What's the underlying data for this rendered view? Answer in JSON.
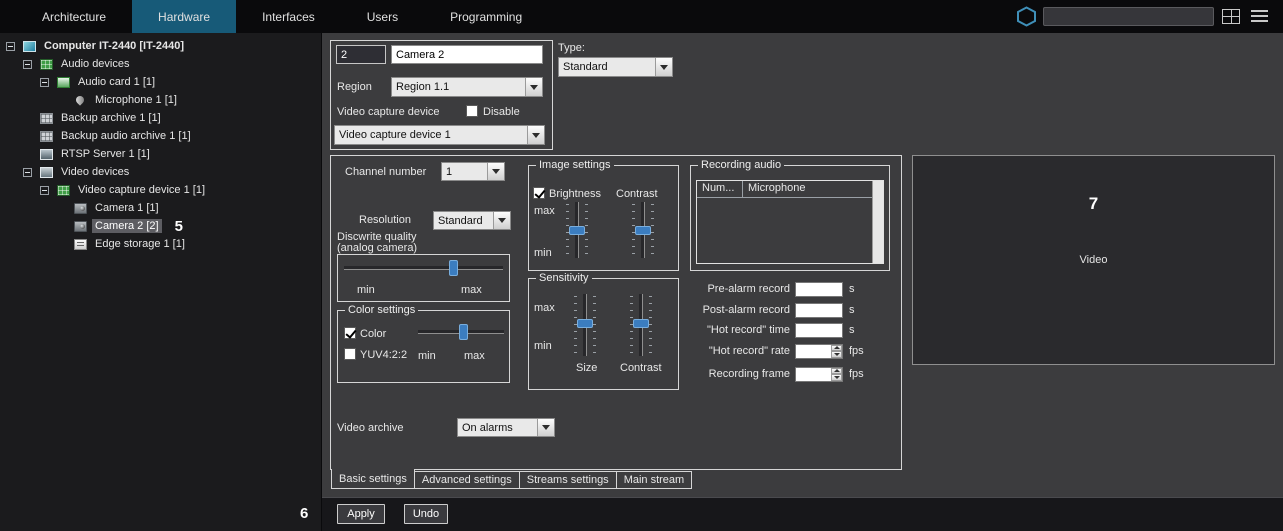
{
  "topbar": {
    "menu": [
      {
        "label": "Architecture",
        "active": false
      },
      {
        "label": "Hardware",
        "active": true
      },
      {
        "label": "Interfaces",
        "active": false
      },
      {
        "label": "Users",
        "active": false
      },
      {
        "label": "Programming",
        "active": false
      }
    ],
    "search_value": ""
  },
  "tree": {
    "items": [
      {
        "label": "Computer IT-2440 [IT-2440]",
        "level": 0,
        "icon": "computer",
        "expander": true,
        "bold": true,
        "selected": false
      },
      {
        "label": "Audio devices",
        "level": 1,
        "icon": "audio-devices",
        "expander": true
      },
      {
        "label": "Audio card 1 [1]",
        "level": 2,
        "icon": "audio-card",
        "expander": true
      },
      {
        "label": "Microphone 1 [1]",
        "level": 3,
        "icon": "microphone"
      },
      {
        "label": "Backup archive 1 [1]",
        "level": 1,
        "icon": "backup-archive"
      },
      {
        "label": "Backup audio archive 1 [1]",
        "level": 1,
        "icon": "backup-audio-archive"
      },
      {
        "label": "RTSP Server 1 [1]",
        "level": 1,
        "icon": "rtsp-server"
      },
      {
        "label": "Video devices",
        "level": 1,
        "icon": "video-devices",
        "expander": true
      },
      {
        "label": "Video capture device 1 [1]",
        "level": 2,
        "icon": "video-capture-device",
        "expander": true
      },
      {
        "label": "Camera 1 [1]",
        "level": 3,
        "icon": "camera"
      },
      {
        "label": "Camera 2 [2]",
        "level": 3,
        "icon": "camera",
        "selected": true,
        "annotation": "5"
      },
      {
        "label": "Edge storage 1 [1]",
        "level": 3,
        "icon": "edge-storage"
      }
    ]
  },
  "identity": {
    "id_value": "2",
    "name_value": "Camera 2",
    "type_label": "Type:",
    "type_value": "Standard",
    "region_label": "Region",
    "region_value": "Region 1.1",
    "capture_label": "Video capture device",
    "disable_label": "Disable",
    "disable_checked": false,
    "capture_value": "Video capture device 1"
  },
  "settings": {
    "channel_label": "Channel number",
    "channel_value": "1",
    "resolution_label": "Resolution",
    "resolution_value": "Standard",
    "discwrite_line1": "Discwrite quality",
    "discwrite_line2": "(analog camera)",
    "disc_min": "min",
    "disc_max": "max",
    "color_group": {
      "title": "Color settings",
      "color_label": "Color",
      "color_checked": true,
      "yuv_label": "YUV4:2:2",
      "yuv_checked": false,
      "min": "min",
      "max": "max"
    },
    "image_group": {
      "title": "Image settings",
      "brightness_label": "Brightness",
      "brightness_checked": true,
      "contrast_label": "Contrast",
      "max": "max",
      "min": "min"
    },
    "sensitivity_group": {
      "title": "Sensitivity",
      "max": "max",
      "min": "min",
      "size_label": "Size",
      "contrast_label": "Contrast"
    },
    "recording_audio": {
      "title": "Recording audio",
      "col_num": "Num...",
      "col_mic": "Microphone"
    },
    "records": [
      {
        "label": "Pre-alarm record",
        "unit": "s",
        "spinner": false
      },
      {
        "label": "Post-alarm record",
        "unit": "s",
        "spinner": false
      },
      {
        "label": "\"Hot record\" time",
        "unit": "s",
        "spinner": false
      },
      {
        "label": "\"Hot record\" rate",
        "unit": "fps",
        "spinner": true
      },
      {
        "label": "Recording frame",
        "unit": "fps",
        "spinner": true
      }
    ],
    "archive_label": "Video archive",
    "archive_value": "On alarms",
    "tabs": [
      {
        "label": "Basic settings",
        "active": true
      },
      {
        "label": "Advanced settings",
        "active": false
      },
      {
        "label": "Streams settings",
        "active": false
      },
      {
        "label": "Main stream",
        "active": false
      }
    ]
  },
  "video_panel": {
    "annotation": "7",
    "label": "Video"
  },
  "footer": {
    "apply_label": "Apply",
    "undo_label": "Undo",
    "annotation": "6"
  },
  "colors": {
    "accent": "#175a78",
    "slider": "#3b7dc0",
    "selection": "#5d5d62"
  }
}
